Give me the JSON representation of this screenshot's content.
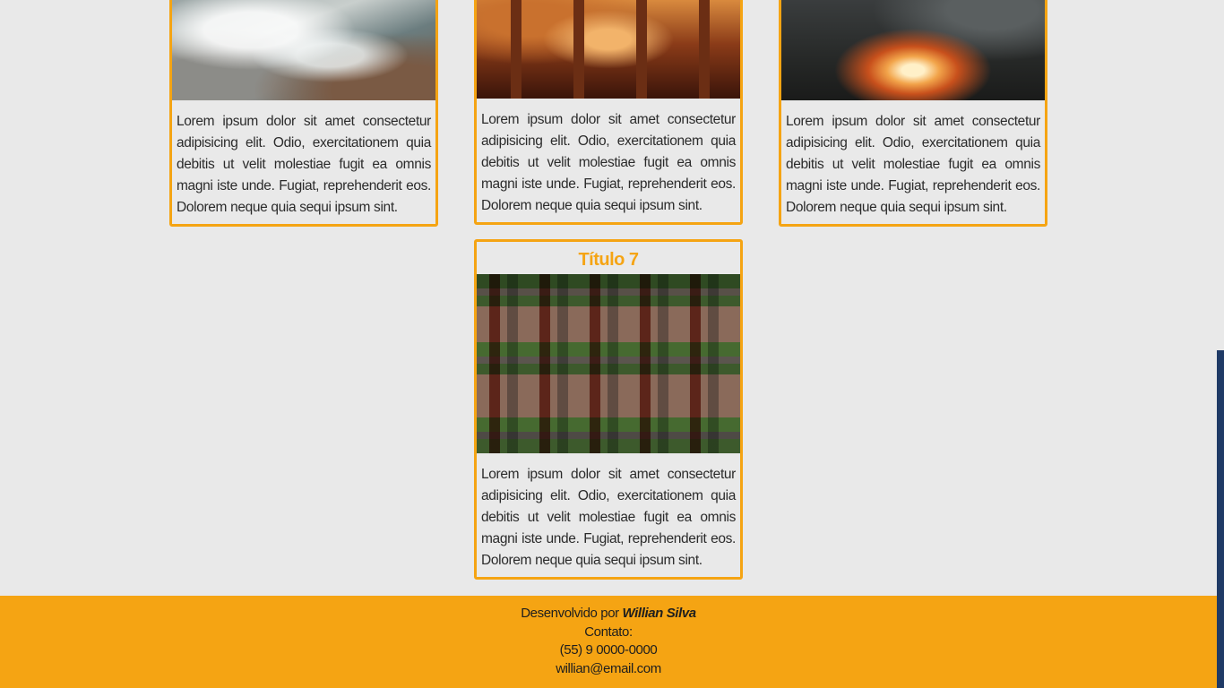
{
  "cards": [
    {
      "image": "ocean-waves-photo",
      "text": "Lorem ipsum dolor sit amet consectetur adipisicing elit. Odio, exercitationem quia debitis ut velit molestiae fugit ea omnis magni iste unde. Fugiat, reprehenderit eos. Dolorem neque quia sequi ipsum sint."
    },
    {
      "image": "theatre-interior-photo",
      "text": "Lorem ipsum dolor sit amet consectetur adipisicing elit. Odio, exercitationem quia debitis ut velit molestiae fugit ea omnis magni iste unde. Fugiat, reprehenderit eos. Dolorem neque quia sequi ipsum sint."
    },
    {
      "image": "campfire-photo",
      "text": "Lorem ipsum dolor sit amet consectetur adipisicing elit. Odio, exercitationem quia debitis ut velit molestiae fugit ea omnis magni iste unde. Fugiat, reprehenderit eos. Dolorem neque quia sequi ipsum sint."
    },
    {
      "title": "Título 7",
      "image": "aerial-houses-photo",
      "text": "Lorem ipsum dolor sit amet consectetur adipisicing elit. Odio, exercitationem quia debitis ut velit molestiae fugit ea omnis magni iste unde. Fugiat, reprehenderit eos. Dolorem neque quia sequi ipsum sint."
    }
  ],
  "footer": {
    "developed_by": "Desenvolvido por",
    "author": "Willian Silva",
    "contact_label": "Contato:",
    "phone": "(55) 9 0000-0000",
    "email": "willian@email.com"
  },
  "colors": {
    "accent": "#f5a413",
    "background": "#e9e9e9",
    "scrollbar": "#1f3a66"
  }
}
